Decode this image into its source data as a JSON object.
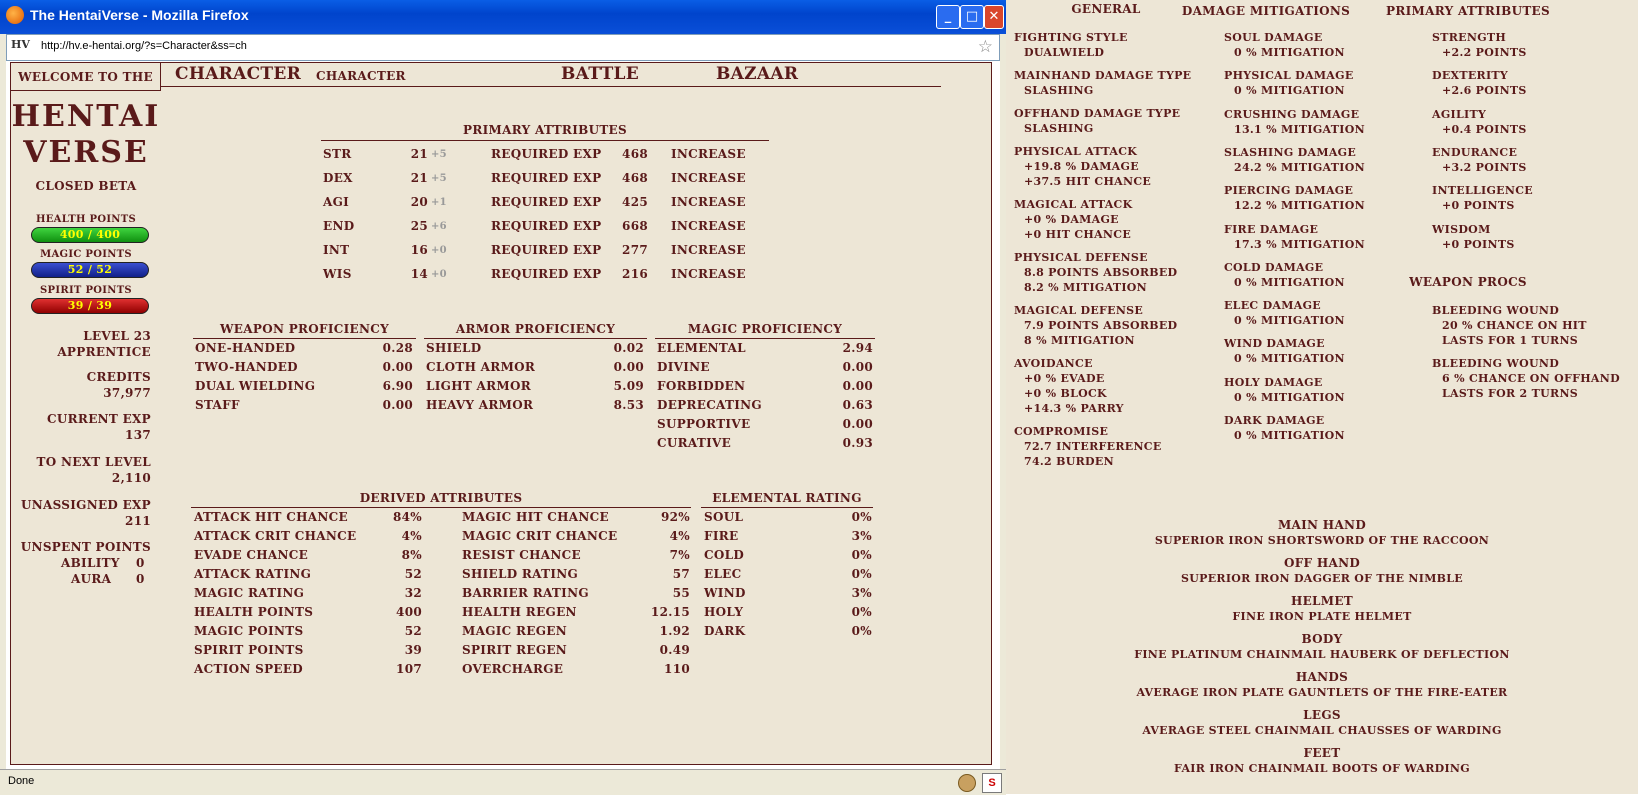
{
  "window": {
    "title": "The HentaiVerse - Mozilla Firefox",
    "url": "http://hv.e-hentai.org/?s=Character&ss=ch",
    "site_icon": "HV",
    "status": "Done"
  },
  "nav": {
    "welcome": "Welcome to the",
    "logo_line1": "HENTAI",
    "logo_line2": "VERSE",
    "beta": "Closed Beta",
    "tab_character": "Character",
    "tab_character_sub": "Character",
    "tab_battle": "Battle",
    "tab_bazaar": "Bazaar"
  },
  "bars": {
    "health_label": "Health Points",
    "health": "400 / 400",
    "magic_label": "Magic Points",
    "magic": "52 / 52",
    "spirit_label": "Spirit Points",
    "spirit": "39 / 39"
  },
  "stats": {
    "level": "Level 23",
    "rank": "Apprentice",
    "credits_label": "Credits",
    "credits": "37,977",
    "current_exp_label": "Current Exp",
    "current_exp": "137",
    "next_level_label": "To Next Level",
    "next_level": "2,110",
    "unassigned_label": "Unassigned Exp",
    "unassigned": "211",
    "unspent_label": "Unspent Points",
    "ability_label": "Ability",
    "ability": "0",
    "aura_label": "Aura",
    "aura": "0"
  },
  "primary": {
    "title": "Primary Attributes",
    "req_label": "Required Exp",
    "increase_label": "Increase",
    "rows": [
      {
        "name": "STR",
        "value": "21",
        "bonus": "+5",
        "req": "468"
      },
      {
        "name": "DEX",
        "value": "21",
        "bonus": "+5",
        "req": "468"
      },
      {
        "name": "AGI",
        "value": "20",
        "bonus": "+1",
        "req": "425"
      },
      {
        "name": "END",
        "value": "25",
        "bonus": "+6",
        "req": "668"
      },
      {
        "name": "INT",
        "value": "16",
        "bonus": "+0",
        "req": "277"
      },
      {
        "name": "WIS",
        "value": "14",
        "bonus": "+0",
        "req": "216"
      }
    ]
  },
  "proficiency": {
    "weapon_title": "Weapon Proficiency",
    "weapon": [
      {
        "name": "One-Handed",
        "value": "0.28"
      },
      {
        "name": "Two-Handed",
        "value": "0.00"
      },
      {
        "name": "Dual Wielding",
        "value": "6.90"
      },
      {
        "name": "Staff",
        "value": "0.00"
      }
    ],
    "armor_title": "Armor Proficiency",
    "armor": [
      {
        "name": "Shield",
        "value": "0.02"
      },
      {
        "name": "Cloth Armor",
        "value": "0.00"
      },
      {
        "name": "Light Armor",
        "value": "5.09"
      },
      {
        "name": "Heavy Armor",
        "value": "8.53"
      }
    ],
    "magic_title": "Magic Proficiency",
    "magic": [
      {
        "name": "Elemental",
        "value": "2.94"
      },
      {
        "name": "Divine",
        "value": "0.00"
      },
      {
        "name": "Forbidden",
        "value": "0.00"
      },
      {
        "name": "Deprecating",
        "value": "0.63"
      },
      {
        "name": "Supportive",
        "value": "0.00"
      },
      {
        "name": "Curative",
        "value": "0.93"
      }
    ]
  },
  "derived": {
    "title": "Derived Attributes",
    "left": [
      {
        "name": "Attack Hit Chance",
        "value": "84%"
      },
      {
        "name": "Attack Crit Chance",
        "value": "4%"
      },
      {
        "name": "Evade Chance",
        "value": "8%"
      },
      {
        "name": "Attack Rating",
        "value": "52"
      },
      {
        "name": "Magic Rating",
        "value": "32"
      },
      {
        "name": "Health Points",
        "value": "400"
      },
      {
        "name": "Magic Points",
        "value": "52"
      },
      {
        "name": "Spirit Points",
        "value": "39"
      },
      {
        "name": "Action Speed",
        "value": "107"
      }
    ],
    "right": [
      {
        "name": "Magic Hit Chance",
        "value": "92%"
      },
      {
        "name": "Magic Crit Chance",
        "value": "4%"
      },
      {
        "name": "Resist Chance",
        "value": "7%"
      },
      {
        "name": "Shield Rating",
        "value": "57"
      },
      {
        "name": "Barrier Rating",
        "value": "55"
      },
      {
        "name": "Health Regen",
        "value": "12.15"
      },
      {
        "name": "Magic Regen",
        "value": "1.92"
      },
      {
        "name": "Spirit Regen",
        "value": "0.49"
      },
      {
        "name": "Overcharge",
        "value": "110"
      }
    ]
  },
  "elemental": {
    "title": "Elemental Rating",
    "rows": [
      {
        "name": "Soul",
        "value": "0%"
      },
      {
        "name": "Fire",
        "value": "3%"
      },
      {
        "name": "Cold",
        "value": "0%"
      },
      {
        "name": "Elec",
        "value": "0%"
      },
      {
        "name": "Wind",
        "value": "3%"
      },
      {
        "name": "Holy",
        "value": "0%"
      },
      {
        "name": "Dark",
        "value": "0%"
      }
    ]
  },
  "panel": {
    "general_title": "General",
    "general": [
      {
        "head": "Fighting Style",
        "lines": [
          "Dualwield"
        ]
      },
      {
        "head": "Mainhand Damage Type",
        "lines": [
          "Slashing"
        ]
      },
      {
        "head": "Offhand Damage Type",
        "lines": [
          "Slashing"
        ]
      },
      {
        "head": "Physical Attack",
        "lines": [
          "+19.8 % Damage",
          "+37.5 Hit Chance"
        ]
      },
      {
        "head": "Magical Attack",
        "lines": [
          "+0 % Damage",
          "+0 Hit Chance"
        ]
      },
      {
        "head": "Physical Defense",
        "lines": [
          "8.8 Points Absorbed",
          "8.2 % Mitigation"
        ]
      },
      {
        "head": "Magical Defense",
        "lines": [
          "7.9 Points Absorbed",
          "8 % Mitigation"
        ]
      },
      {
        "head": "Avoidance",
        "lines": [
          "+0 % Evade",
          "+0 % Block",
          "+14.3 % Parry"
        ]
      },
      {
        "head": "Compromise",
        "lines": [
          "72.7 Interference",
          "74.2 Burden"
        ]
      }
    ],
    "mitigation_title": "Damage Mitigations",
    "mitigation": [
      {
        "head": "Soul Damage",
        "line": "0 % Mitigation"
      },
      {
        "head": "Physical Damage",
        "line": "0 % Mitigation"
      },
      {
        "head": "Crushing Damage",
        "line": "13.1 % Mitigation"
      },
      {
        "head": "Slashing Damage",
        "line": "24.2 % Mitigation"
      },
      {
        "head": "Piercing Damage",
        "line": "12.2 % Mitigation"
      },
      {
        "head": "Fire Damage",
        "line": "17.3 % Mitigation"
      },
      {
        "head": "Cold Damage",
        "line": "0 % Mitigation"
      },
      {
        "head": "Elec Damage",
        "line": "0 % Mitigation"
      },
      {
        "head": "Wind Damage",
        "line": "0 % Mitigation"
      },
      {
        "head": "Holy Damage",
        "line": "0 % Mitigation"
      },
      {
        "head": "Dark Damage",
        "line": "0 % Mitigation"
      }
    ],
    "primary_title": "Primary Attributes",
    "primary": [
      {
        "head": "Strength",
        "line": "+2.2 Points"
      },
      {
        "head": "Dexterity",
        "line": "+2.6 Points"
      },
      {
        "head": "Agility",
        "line": "+0.4 Points"
      },
      {
        "head": "Endurance",
        "line": "+3.2 Points"
      },
      {
        "head": "Intelligence",
        "line": "+0 Points"
      },
      {
        "head": "Wisdom",
        "line": "+0 Points"
      }
    ],
    "procs_title": "Weapon Procs",
    "procs": [
      {
        "head": "Bleeding Wound",
        "lines": [
          "20 % chance on hit",
          "lasts for 1 turns"
        ]
      },
      {
        "head": "Bleeding Wound",
        "lines": [
          "6 % chance on offhand",
          "lasts for 2 turns"
        ]
      }
    ],
    "equipment": [
      {
        "slot": "Main Hand",
        "item": "Superior Iron Shortsword of the Raccoon"
      },
      {
        "slot": "Off Hand",
        "item": "Superior Iron Dagger of the Nimble"
      },
      {
        "slot": "Helmet",
        "item": "Fine Iron Plate Helmet"
      },
      {
        "slot": "Body",
        "item": "Fine Platinum Chainmail Hauberk of Deflection"
      },
      {
        "slot": "Hands",
        "item": "Average Iron Plate Gauntlets of the Fire-eater"
      },
      {
        "slot": "Legs",
        "item": "Average Steel Chainmail Chausses of Warding"
      },
      {
        "slot": "Feet",
        "item": "Fair Iron Chainmail Boots of Warding"
      }
    ]
  }
}
